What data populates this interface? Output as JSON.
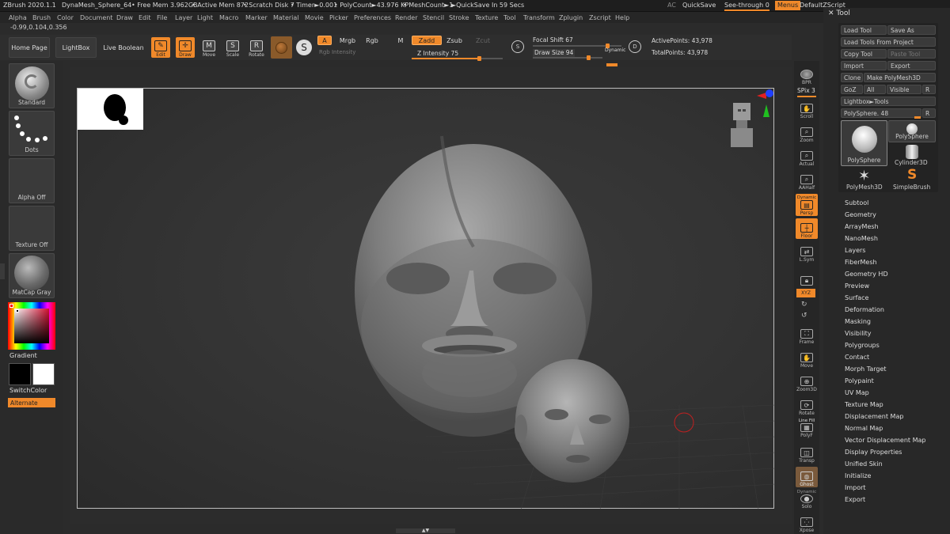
{
  "titlebar": {
    "app": "ZBrush 2020.1.1",
    "doc": "DynaMesh_Sphere_64",
    "free_mem": "• Free Mem 3.962GB",
    "active_mem": "• Active Mem 872",
    "scratch": "• Scratch Disk 7",
    "timer": "• Timer►0.001",
    "polycount": "• PolyCount►43.976 KP",
    "meshcount": "• MeshCount►1",
    "quicksave_in": "►QuickSave In 59 Secs",
    "ac": "AC",
    "quicksave": "QuickSave",
    "see_through": "See-through  0",
    "menus": "Menus",
    "default_zscript": "DefaultZScript"
  },
  "menu": [
    "Alpha",
    "Brush",
    "Color",
    "Document",
    "Draw",
    "Edit",
    "File",
    "Layer",
    "Light",
    "Macro",
    "Marker",
    "Material",
    "Movie",
    "Picker",
    "Preferences",
    "Render",
    "Stencil",
    "Stroke",
    "Texture",
    "Tool",
    "Transform",
    "Zplugin",
    "Zscript",
    "Help"
  ],
  "coords": "-0.99,0.104,0.356",
  "toolbar": {
    "home_page": "Home Page",
    "lightbox": "LightBox",
    "live_boolean": "Live Boolean",
    "edit": "Edit",
    "draw": "Draw",
    "move": "Move",
    "scale": "Scale",
    "rotate": "Rotate",
    "a": "A",
    "mrgb": "Mrgb",
    "rgb": "Rgb",
    "m": "M",
    "rgb_intensity": "Rgb Intensity",
    "zadd": "Zadd",
    "zsub": "Zsub",
    "zcut": "Zcut",
    "z_intensity": "Z Intensity 75",
    "z_intensity_value": 0.75,
    "focal_shift": "Focal Shift 67",
    "draw_size": "Draw Size 94",
    "dynamic": "Dynamic",
    "active_points": "ActivePoints: 43,978",
    "total_points": "TotalPoints: 43,978"
  },
  "left": {
    "standard": "Standard",
    "dots": "Dots",
    "alpha_off": "Alpha Off",
    "texture_off": "Texture Off",
    "matcap": "MatCap Gray",
    "gradient": "Gradient",
    "switch_color": "SwitchColor",
    "alternate": "Alternate"
  },
  "shelf": {
    "bpr": "BPR",
    "spix": "SPix 3",
    "scroll": "Scroll",
    "zoom": "Zoom",
    "actual": "Actual",
    "aahalf": "AAHalf",
    "dynamic": "Dynamic",
    "persp": "Persp",
    "floor": "Floor",
    "lsym": "L.Sym",
    "xyz": "XYZ",
    "frame": "Frame",
    "move": "Move",
    "zoom3d": "Zoom3D",
    "rotate": "Rotate",
    "line_fill": "Line Fill",
    "polyf": "PolyF",
    "transp": "Transp",
    "ghost": "Ghost",
    "dynamic2": "Dynamic",
    "solo": "Solo",
    "xpose": "Xpose"
  },
  "tool": {
    "title": "Tool",
    "load_tool": "Load Tool",
    "save_as": "Save As",
    "load_from_project": "Load Tools From Project",
    "copy_tool": "Copy Tool",
    "paste_tool": "Paste Tool",
    "import": "Import",
    "export": "Export",
    "clone": "Clone",
    "make_polymesh": "Make PolyMesh3D",
    "goz": "GoZ",
    "all": "All",
    "visible": "Visible",
    "r": "R",
    "lightbox_tools": "Lightbox►Tools",
    "polysphere_slider": "PolySphere. 48",
    "thumbs": [
      "PolySphere",
      "PolySphere",
      "Cylinder3D",
      "PolyMesh3D",
      "SimpleBrush"
    ],
    "sections": [
      "Subtool",
      "Geometry",
      "ArrayMesh",
      "NanoMesh",
      "Layers",
      "FiberMesh",
      "Geometry HD",
      "Preview",
      "Surface",
      "Deformation",
      "Masking",
      "Visibility",
      "Polygroups",
      "Contact",
      "Morph Target",
      "Polypaint",
      "UV Map",
      "Texture Map",
      "Displacement Map",
      "Normal Map",
      "Vector Displacement Map",
      "Display Properties",
      "Unified Skin",
      "Initialize",
      "Import",
      "Export"
    ]
  },
  "colors": {
    "accent": "#f0892a",
    "background": "#2b2b2b"
  }
}
